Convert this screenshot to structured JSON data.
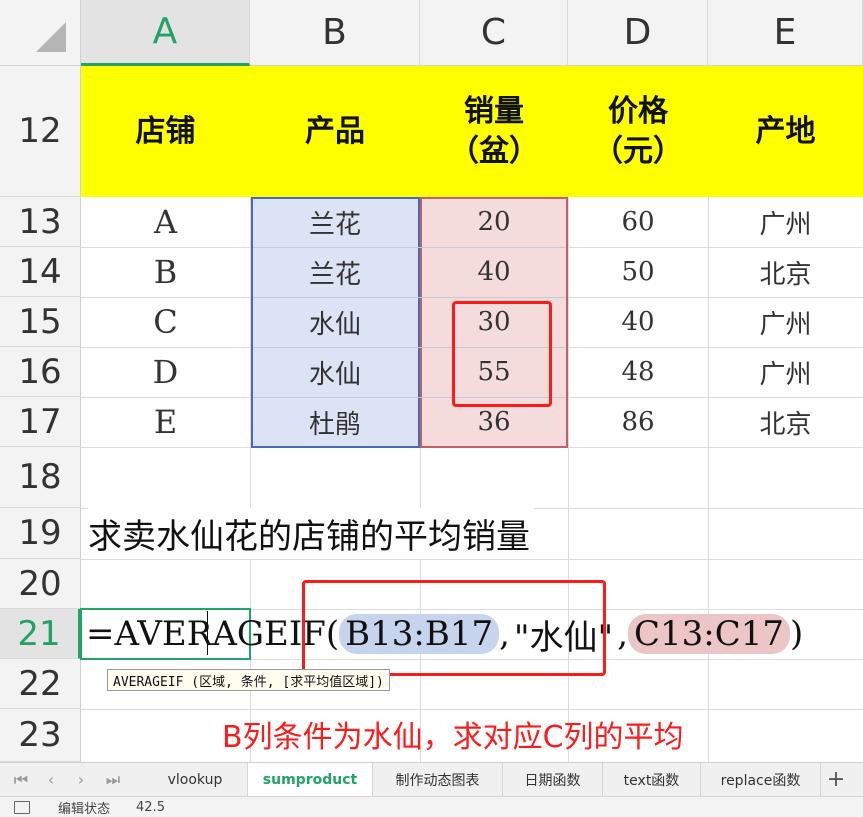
{
  "columns": [
    "A",
    "B",
    "C",
    "D",
    "E"
  ],
  "active_column": "A",
  "rows": [
    "12",
    "13",
    "14",
    "15",
    "16",
    "17",
    "18",
    "19",
    "20",
    "21",
    "22",
    "23"
  ],
  "active_row": "21",
  "header_row": {
    "shop": "店铺",
    "product": "产品",
    "sales_line1": "销量",
    "sales_line2": "（盆）",
    "price_line1": "价格",
    "price_line2": "（元）",
    "origin": "产地"
  },
  "table": [
    {
      "shop": "A",
      "product": "兰花",
      "sales": "20",
      "price": "60",
      "origin": "广州"
    },
    {
      "shop": "B",
      "product": "兰花",
      "sales": "40",
      "price": "50",
      "origin": "北京"
    },
    {
      "shop": "C",
      "product": "水仙",
      "sales": "30",
      "price": "40",
      "origin": "广州"
    },
    {
      "shop": "D",
      "product": "水仙",
      "sales": "55",
      "price": "48",
      "origin": "广州"
    },
    {
      "shop": "E",
      "product": "杜鹃",
      "sales": "36",
      "price": "86",
      "origin": "北京"
    }
  ],
  "question": "求卖水仙花的店铺的平均销量",
  "formula": {
    "prefix": "=AVERAGEIF(",
    "range_ref": "B13:B17",
    "sep1": ",",
    "criteria": "\"水仙\"",
    "sep2": ",",
    "avg_ref": "C13:C17",
    "suffix": ")"
  },
  "tooltip": "AVERAGEIF (区域, 条件, [求平均值区域])",
  "caption": "B列条件为水仙，求对应C列的平均",
  "sheet_tabs": [
    "vlookup",
    "sumproduct",
    "制作动态图表",
    "日期函数",
    "text函数",
    "replace函数"
  ],
  "active_tab": "sumproduct",
  "add_tab": "+",
  "status": {
    "mode": "编辑状态",
    "value": "42.5"
  },
  "colors": {
    "header_fill": "#ffff00",
    "range_b_fill": "#dce3f5",
    "range_c_fill": "#f4dcdc",
    "highlight_red": "#ff1a1a",
    "accent_green": "#21a366"
  }
}
